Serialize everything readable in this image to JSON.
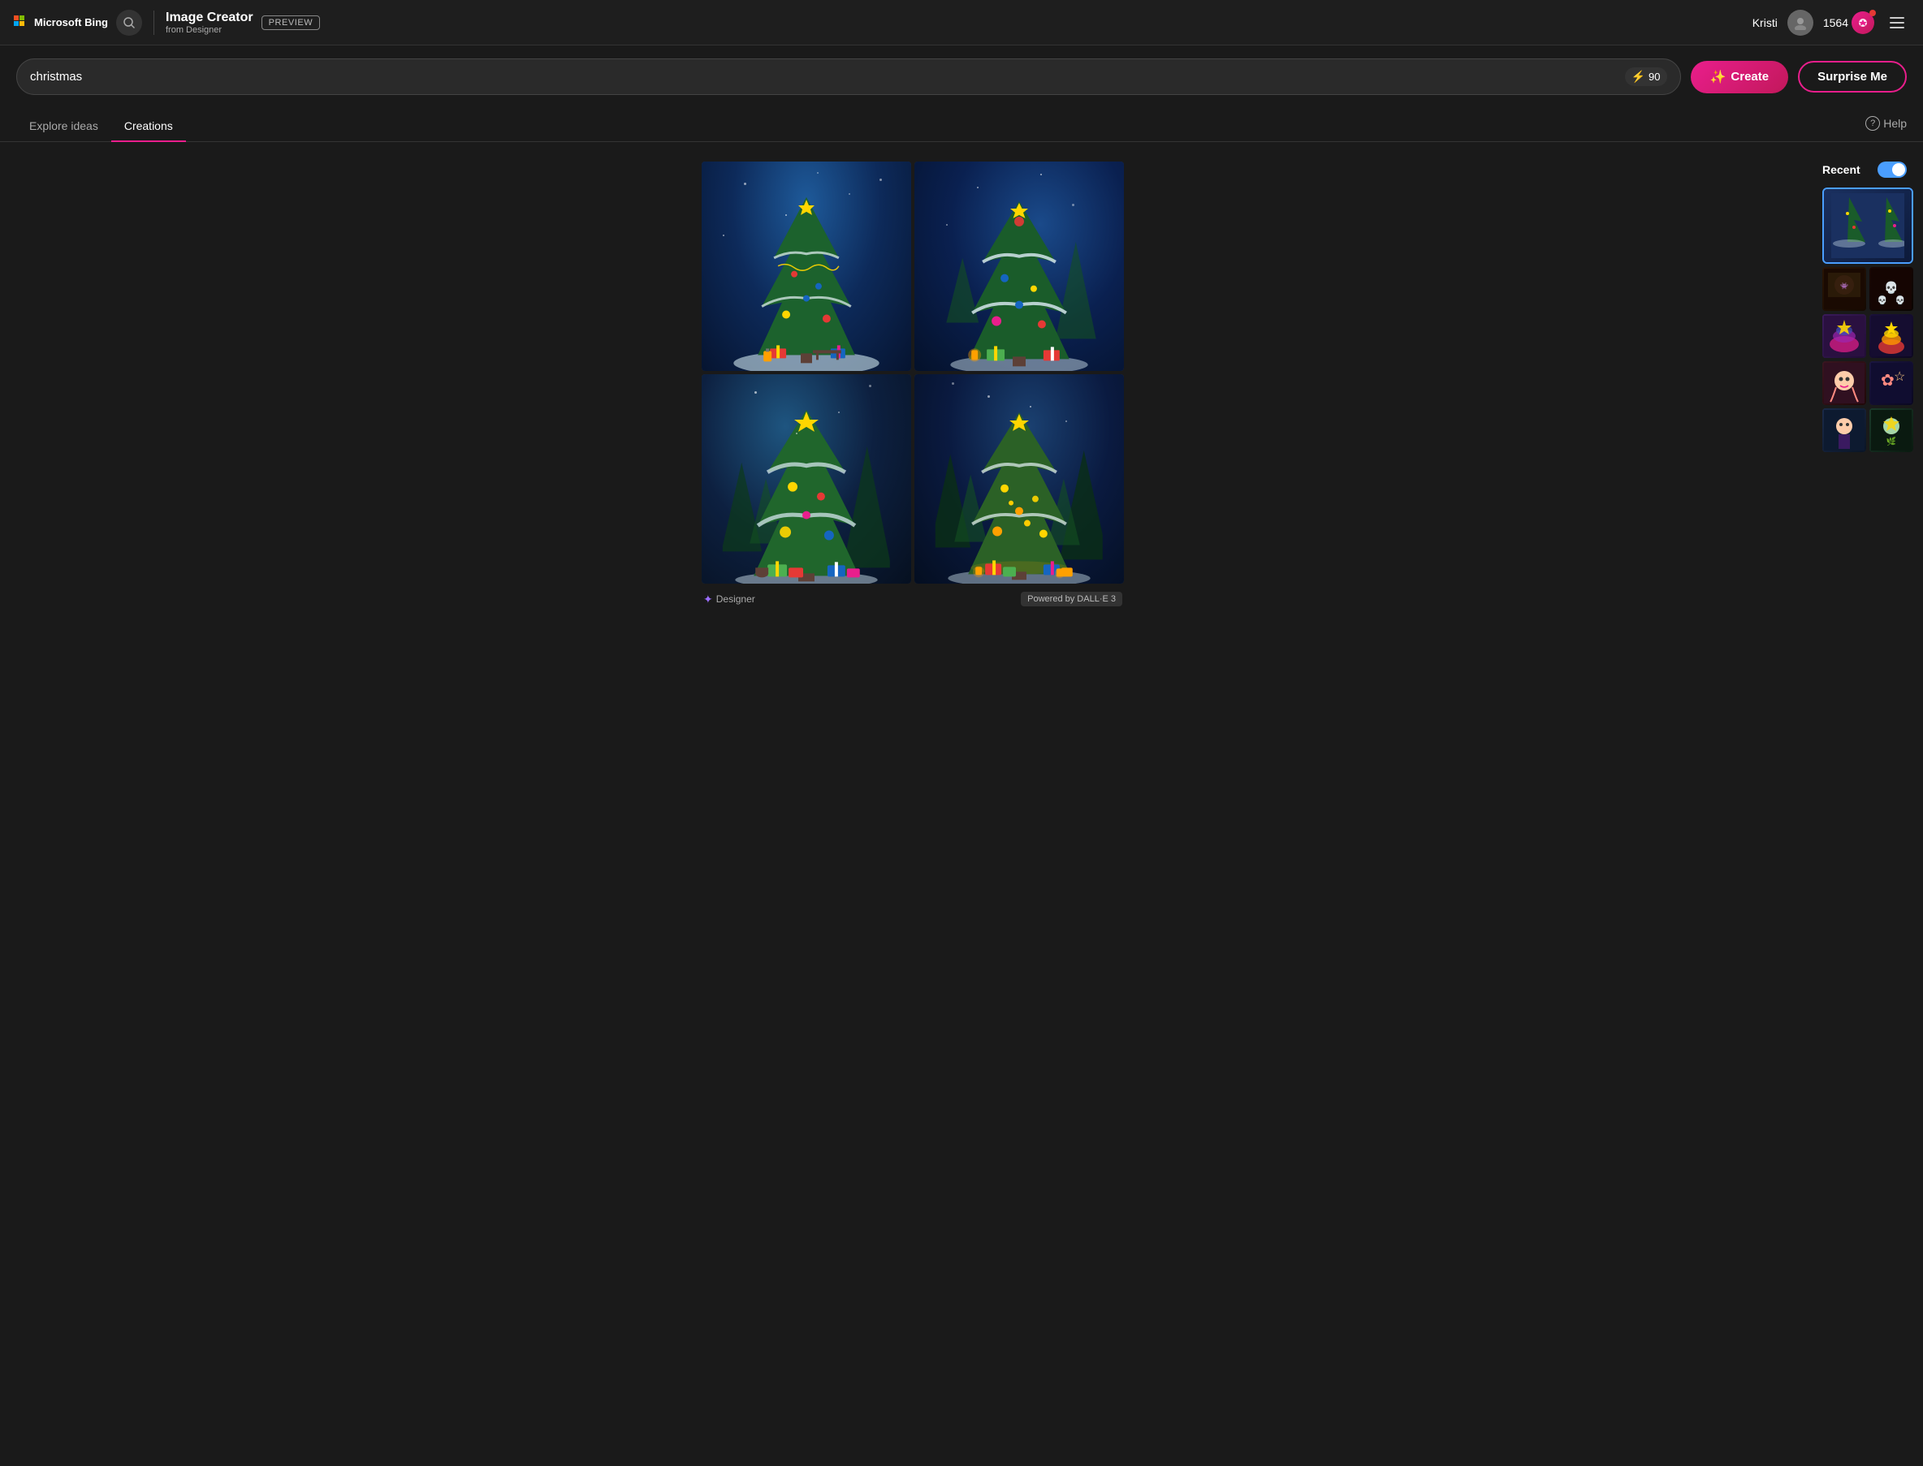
{
  "header": {
    "bing_logo": "Microsoft Bing",
    "app_title": "Image Creator",
    "app_subtitle": "from Designer",
    "preview_label": "PREVIEW",
    "user_name": "Kristi",
    "coins_count": "1564",
    "coins_icon": "⚡"
  },
  "search": {
    "input_value": "christmas",
    "boost_count": "90",
    "create_label": "Create",
    "surprise_label": "Surprise Me"
  },
  "tabs": {
    "explore": "Explore ideas",
    "creations": "Creations",
    "help": "Help"
  },
  "sidebar": {
    "recent_label": "Recent",
    "toggle_state": "on"
  },
  "footer": {
    "designer_label": "Designer",
    "powered_label": "Powered by DALL·E 3"
  }
}
